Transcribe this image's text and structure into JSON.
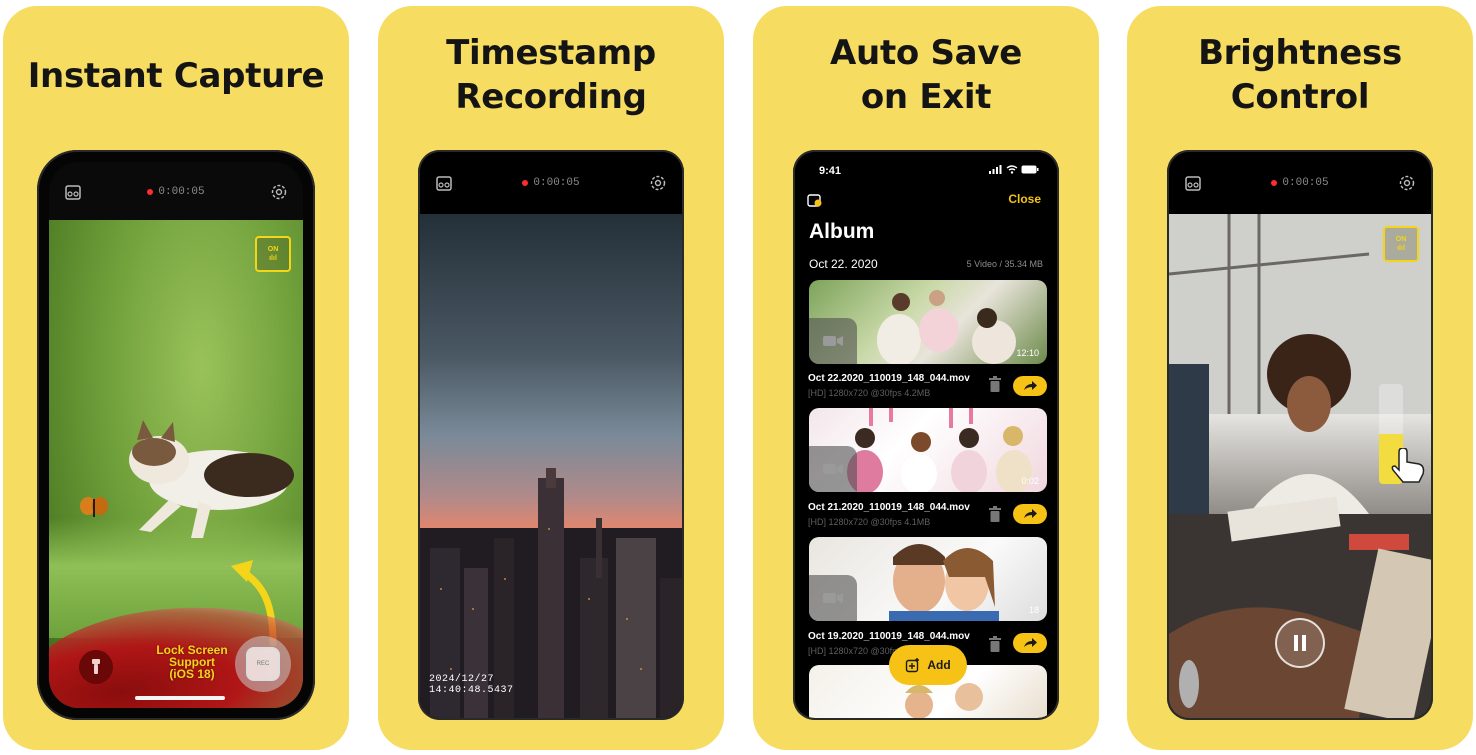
{
  "panels": [
    {
      "title": "Instant Capture"
    },
    {
      "title_line1": "Timestamp",
      "title_line2": "Recording"
    },
    {
      "title_line1": "Auto Save",
      "title_line2": "on Exit"
    },
    {
      "title_line1": "Brightness",
      "title_line2": "Control"
    }
  ],
  "recorder": {
    "timer": "0:00:05",
    "on_badge": "ON",
    "lock_screen_line1": "Lock Screen",
    "lock_screen_line2": "Support",
    "lock_screen_line3": "(iOS 18)",
    "shutter_label": "REC"
  },
  "timestamp": {
    "date": "2024/12/27",
    "time": "14:40:48.5437"
  },
  "album": {
    "status_time": "9:41",
    "close_label": "Close",
    "title": "Album",
    "date": "Oct 22. 2020",
    "summary": "5 Video / 35.34 MB",
    "videos": [
      {
        "name": "Oct 22.2020_110019_148_044.mov",
        "meta": "[HD] 1280x720 @30fps 4.2MB",
        "duration": "12:10"
      },
      {
        "name": "Oct 21.2020_110019_148_044.mov",
        "meta": "[HD] 1280x720 @30fps 4.1MB",
        "duration": "0:02"
      },
      {
        "name": "Oct 19.2020_110019_148_044.mov",
        "meta": "[HD] 1280x720 @30fps 4.2MB",
        "duration": "18"
      }
    ],
    "add_label": "Add"
  },
  "brightness": {
    "on_badge": "ON",
    "level": 0.5
  },
  "colors": {
    "panel_bg": "#f7dc62",
    "accent": "#f6c216",
    "rec_dot": "#ff2d2d"
  }
}
